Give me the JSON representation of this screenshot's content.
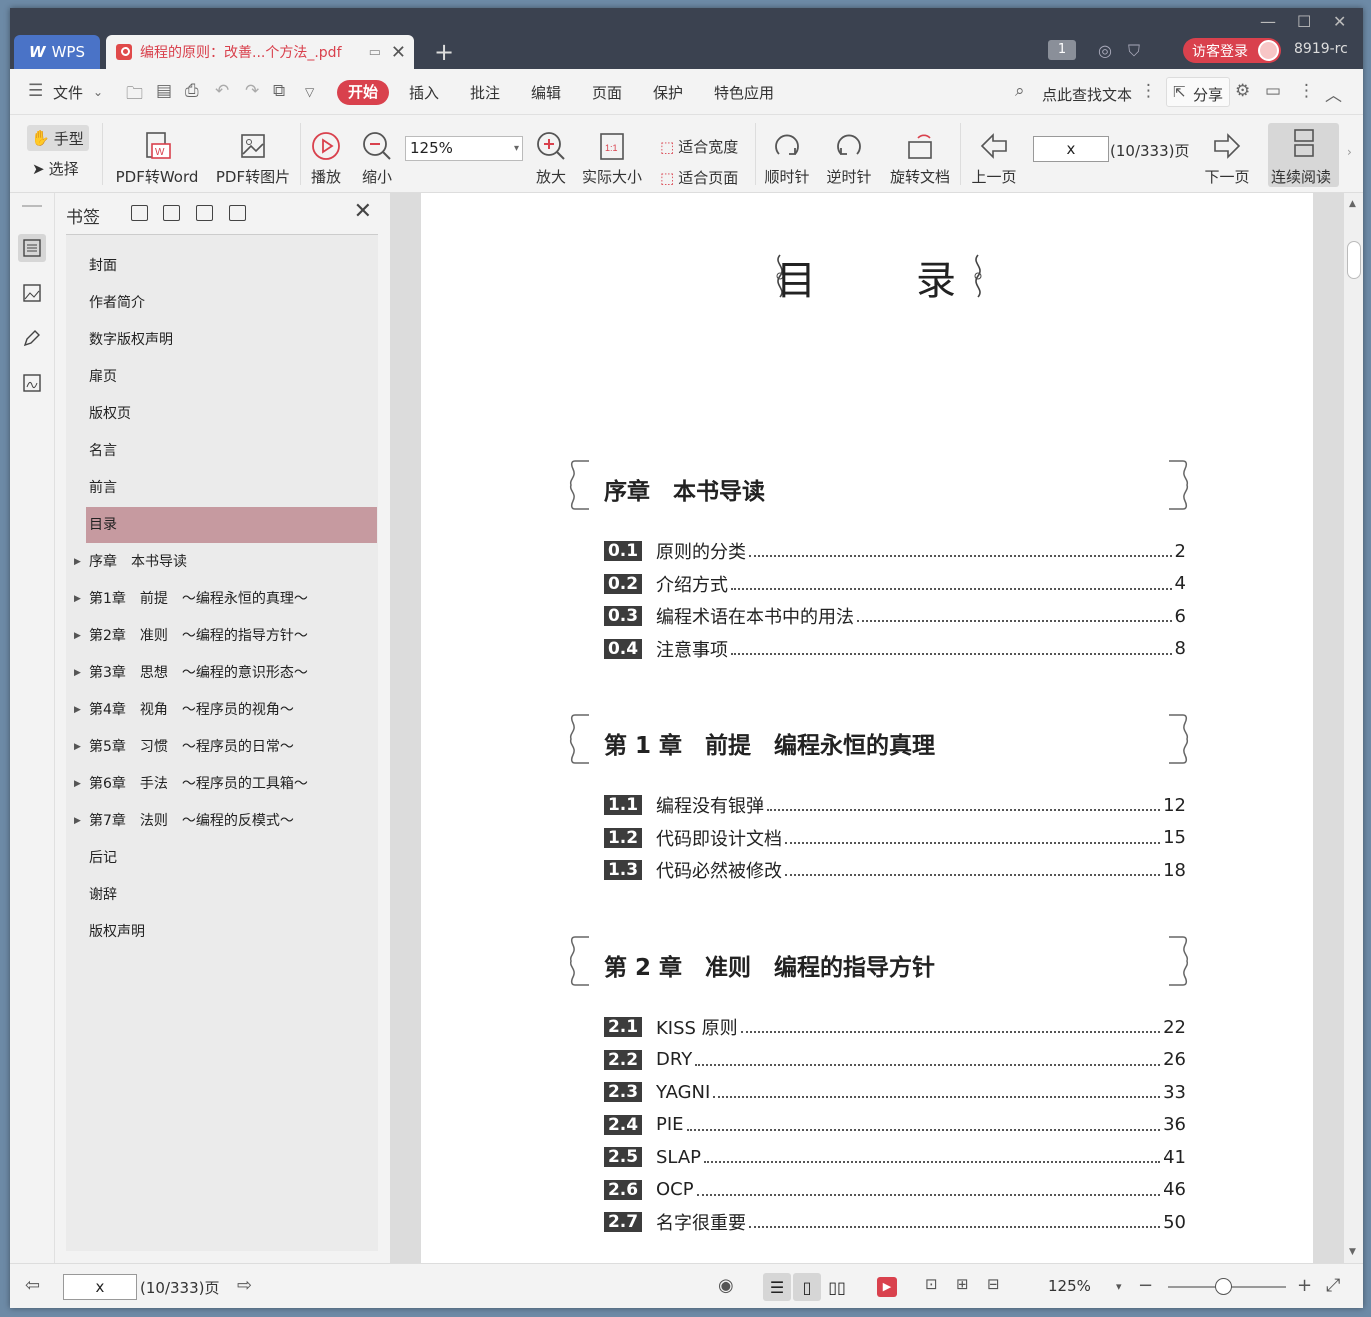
{
  "titlebar": {
    "app_tab": "WPS",
    "doc_tab": "编程的原则：改善...个方法_.pdf",
    "page_badge": "1",
    "login_button": "访客登录",
    "username": "8919-rc"
  },
  "menubar": {
    "file": "文件",
    "tabs": [
      "开始",
      "插入",
      "批注",
      "编辑",
      "页面",
      "保护",
      "特色应用"
    ],
    "active_tab": "开始",
    "search": "点此查找文本",
    "share": "分享"
  },
  "toolbar": {
    "hand": "手型",
    "select": "选择",
    "pdf_to_word": "PDF转Word",
    "pdf_to_image": "PDF转图片",
    "play": "播放",
    "zoom_out": "缩小",
    "zoom_value": "125%",
    "zoom_in": "放大",
    "actual_size": "实际大小",
    "fit_width": "适合宽度",
    "fit_page": "适合页面",
    "clockwise": "顺时针",
    "counterclockwise": "逆时针",
    "rotate_doc": "旋转文档",
    "prev_page": "上一页",
    "page_input": "x",
    "page_total": "(10/333)页",
    "next_page": "下一页",
    "continuous": "连续阅读"
  },
  "bookmarks": {
    "title": "书签",
    "items": [
      {
        "label": "封面",
        "expandable": false
      },
      {
        "label": "作者简介",
        "expandable": false
      },
      {
        "label": "数字版权声明",
        "expandable": false
      },
      {
        "label": "扉页",
        "expandable": false
      },
      {
        "label": "版权页",
        "expandable": false
      },
      {
        "label": "名言",
        "expandable": false
      },
      {
        "label": "前言",
        "expandable": false
      },
      {
        "label": "目录",
        "expandable": false,
        "selected": true
      },
      {
        "label": "序章　本书导读",
        "expandable": true
      },
      {
        "label": "第1章　前提　～编程永恒的真理～",
        "expandable": true
      },
      {
        "label": "第2章　准则　～编程的指导方针～",
        "expandable": true
      },
      {
        "label": "第3章　思想　～编程的意识形态～",
        "expandable": true
      },
      {
        "label": "第4章　视角　～程序员的视角～",
        "expandable": true
      },
      {
        "label": "第5章　习惯　～程序员的日常～",
        "expandable": true
      },
      {
        "label": "第6章　手法　～程序员的工具箱～",
        "expandable": true
      },
      {
        "label": "第7章　法则　～编程的反模式～",
        "expandable": true
      },
      {
        "label": "后记",
        "expandable": false
      },
      {
        "label": "谢辞",
        "expandable": false
      },
      {
        "label": "版权声明",
        "expandable": false
      }
    ]
  },
  "page": {
    "title": "目　录",
    "chapters": [
      {
        "title": "序章　本书导读",
        "entries": [
          {
            "num": "0.1",
            "text": "原则的分类",
            "page": "2"
          },
          {
            "num": "0.2",
            "text": "介绍方式",
            "page": "4"
          },
          {
            "num": "0.3",
            "text": "编程术语在本书中的用法",
            "page": "6"
          },
          {
            "num": "0.4",
            "text": "注意事项",
            "page": "8"
          }
        ]
      },
      {
        "title": "第 1 章　前提　编程永恒的真理",
        "entries": [
          {
            "num": "1.1",
            "text": "编程没有银弹",
            "page": "12"
          },
          {
            "num": "1.2",
            "text": "代码即设计文档",
            "page": "15"
          },
          {
            "num": "1.3",
            "text": "代码必然被修改",
            "page": "18"
          }
        ]
      },
      {
        "title": "第 2 章　准则　编程的指导方针",
        "entries": [
          {
            "num": "2.1",
            "text": "KISS 原则",
            "page": "22"
          },
          {
            "num": "2.2",
            "text": "DRY",
            "page": "26"
          },
          {
            "num": "2.3",
            "text": "YAGNI",
            "page": "33"
          },
          {
            "num": "2.4",
            "text": "PIE",
            "page": "36"
          },
          {
            "num": "2.5",
            "text": "SLAP",
            "page": "41"
          },
          {
            "num": "2.6",
            "text": "OCP",
            "page": "46"
          },
          {
            "num": "2.7",
            "text": "名字很重要",
            "page": "50"
          }
        ]
      }
    ]
  },
  "statusbar": {
    "page_input": "x",
    "page_total": "(10/333)页",
    "zoom": "125%"
  },
  "colors": {
    "accent": "#d9414d",
    "wps_blue": "#4a73c7",
    "selected_bookmark": "#c69aa0"
  }
}
